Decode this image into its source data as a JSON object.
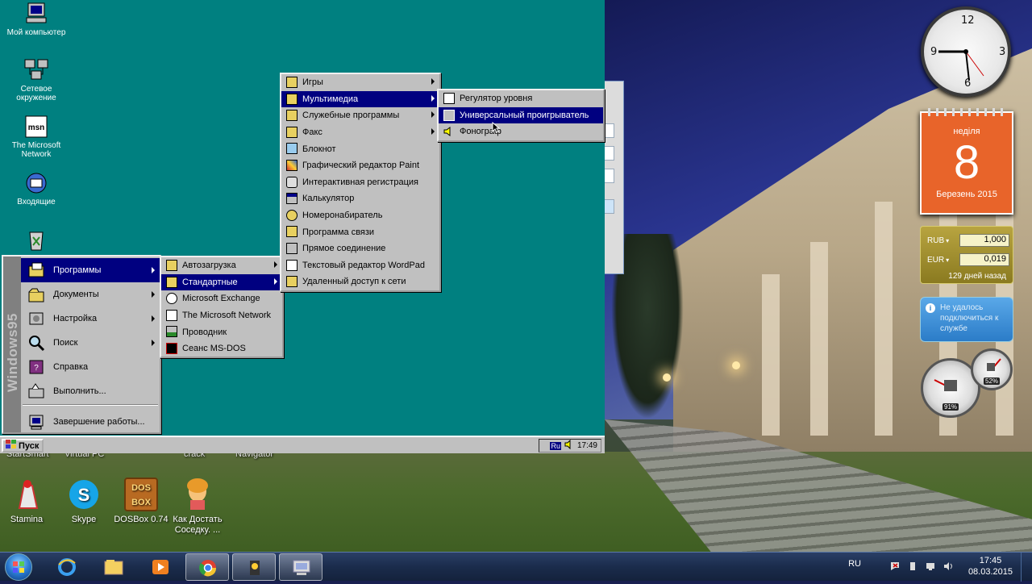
{
  "win95": {
    "desktop_icons": [
      {
        "label": "Мой компьютер",
        "icon": "computer-icon"
      },
      {
        "label": "Сетевое окружение",
        "icon": "network-icon"
      },
      {
        "label": "The Microsoft Network",
        "icon": "msn-icon"
      },
      {
        "label": "Входящие",
        "icon": "inbox-icon"
      },
      {
        "label": "",
        "icon": "recycle-bin-icon"
      }
    ],
    "side_banner": "Windows95",
    "start_menu": [
      {
        "label": "Программы",
        "has_submenu": true,
        "selected": true
      },
      {
        "label": "Документы",
        "has_submenu": true
      },
      {
        "label": "Настройка",
        "has_submenu": true
      },
      {
        "label": "Поиск",
        "has_submenu": true
      },
      {
        "label": "Справка"
      },
      {
        "label": "Выполнить..."
      },
      {
        "label": "Завершение работы..."
      }
    ],
    "programs_menu": [
      {
        "label": "Автозагрузка",
        "has_submenu": true
      },
      {
        "label": "Стандартные",
        "has_submenu": true,
        "selected": true
      },
      {
        "label": "Microsoft Exchange"
      },
      {
        "label": "The Microsoft Network"
      },
      {
        "label": "Проводник"
      },
      {
        "label": "Сеанс MS-DOS"
      }
    ],
    "accessories_menu": [
      {
        "label": "Игры",
        "has_submenu": true
      },
      {
        "label": "Мультимедиа",
        "has_submenu": true,
        "selected": true
      },
      {
        "label": "Служебные программы",
        "has_submenu": true
      },
      {
        "label": "Факс",
        "has_submenu": true
      },
      {
        "label": "Блокнот"
      },
      {
        "label": "Графический редактор Paint"
      },
      {
        "label": "Интерактивная регистрация"
      },
      {
        "label": "Калькулятор"
      },
      {
        "label": "Номеронабиратель"
      },
      {
        "label": "Программа связи"
      },
      {
        "label": "Прямое соединение"
      },
      {
        "label": "Текстовый редактор WordPad"
      },
      {
        "label": "Удаленный доступ к сети"
      }
    ],
    "multimedia_menu": [
      {
        "label": "Регулятор уровня"
      },
      {
        "label": "Универсальный проигрыватель",
        "selected": true
      },
      {
        "label": "Фонограф"
      }
    ],
    "taskbar": {
      "start_label": "Пуск",
      "lang": "Ru",
      "time": "17:49"
    }
  },
  "win7": {
    "partial_labels": [
      "StartSmart",
      "Virtual PC",
      "crack",
      "Navigator"
    ],
    "desktop_icons": [
      {
        "label": "Stamina",
        "icon": "stamina-icon"
      },
      {
        "label": "Skype",
        "icon": "skype-icon"
      },
      {
        "label": "DOSBox 0.74",
        "icon": "dosbox-icon"
      },
      {
        "label": "Как Достать Соседку. ...",
        "icon": "game-icon"
      }
    ],
    "dosbox_icon_text": "DOS BOX",
    "gadgets": {
      "clock_numbers": [
        "12",
        "3",
        "6",
        "9"
      ],
      "calendar": {
        "weekday": "неділя",
        "day": "8",
        "month_year": "Березень 2015"
      },
      "currency": {
        "rows": [
          {
            "code": "RUB",
            "value": "1,000"
          },
          {
            "code": "EUR",
            "value": "0,019"
          }
        ],
        "footer": "129 дней назад"
      },
      "weather_message": "Не удалось подключиться к службе",
      "meter_values": [
        "91%",
        "52%"
      ]
    },
    "taskbar": {
      "lang": "RU",
      "time": "17:45",
      "date": "08.03.2015",
      "pinned": [
        "ie-icon",
        "explorer-icon",
        "media-player-icon",
        "chrome-icon",
        "dosbox-task-icon",
        "win95-vm-icon"
      ]
    }
  }
}
